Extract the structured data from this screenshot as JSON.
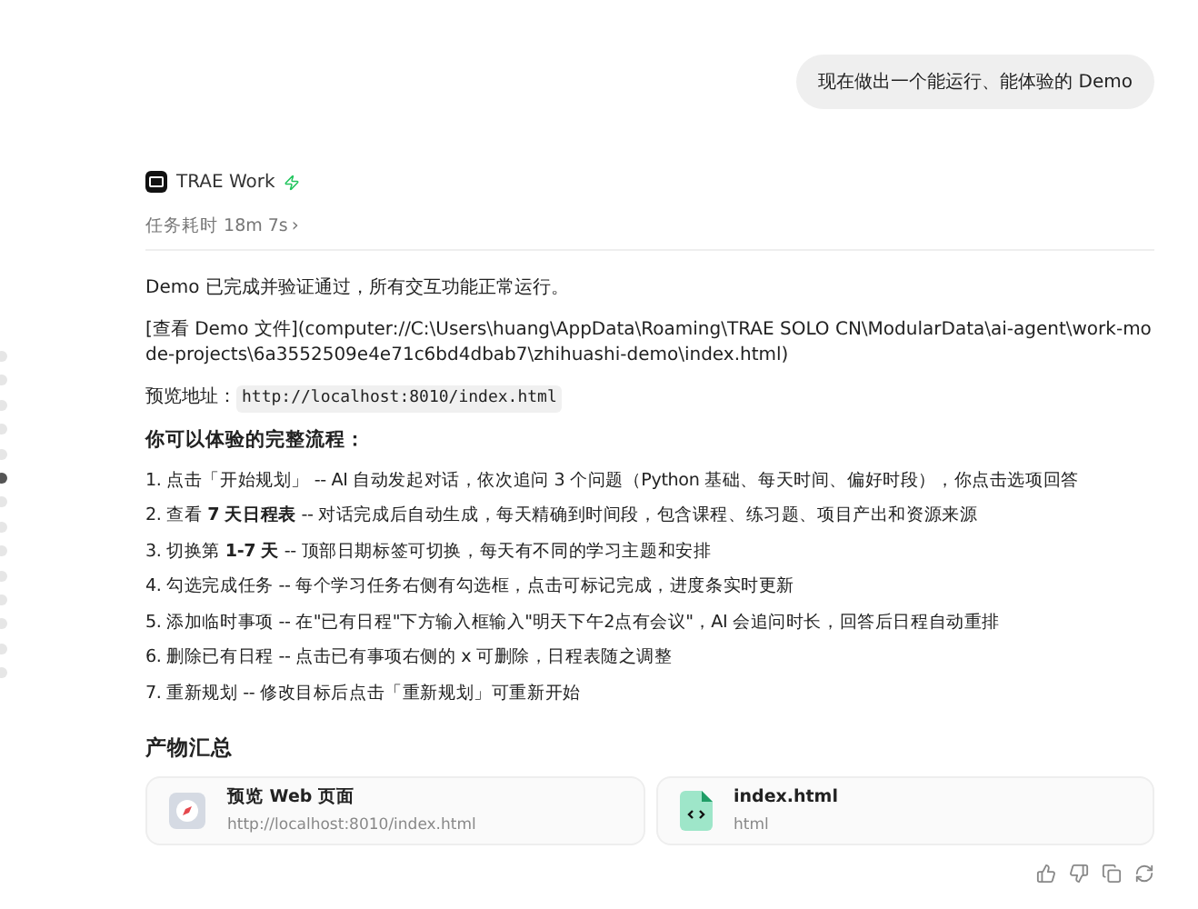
{
  "user_message": "现在做出一个能运行、能体验的 Demo",
  "agent": {
    "name": "TRAE Work",
    "duration": "任务耗时 18m 7s",
    "duration_chevron": "›"
  },
  "paragraphs": [
    "Demo 已完成并验证通过，所有交互功能正常运行。",
    "[查看 Demo 文件](computer://C:\\Users\\huang\\AppData\\Roaming\\TRAE SOLO CN\\ModularData\\ai-agent\\work-mode-projects\\6a3552509e4e71c6bd4dbab7\\zhihuashi-demo\\index.html)"
  ],
  "preview": {
    "label": "预览地址：",
    "url": "http://localhost:8010/index.html"
  },
  "flow_title": "你可以体验的完整流程：",
  "steps": [
    "1. 点击「开始规划」 -- AI 自动发起对话，依次追问 3 个问题（Python 基础、每天时间、偏好时段），你点击选项回答",
    "2. 查看 **7 天日程表** -- 对话完成后自动生成，每天精确到时间段，包含课程、练习题、项目产出和资源来源",
    "3. 切换第 **1-7 天** -- 顶部日期标签可切换，每天有不同的学习主题和安排",
    "4. 勾选完成任务 -- 每个学习任务右侧有勾选框，点击可标记完成，进度条实时更新",
    "5. 添加临时事项 -- 在\"已有日程\"下方输入框输入\"明天下午2点有会议\"，AI 会追问时长，回答后日程自动重排",
    "6. 删除已有日程 -- 点击已有事项右侧的 x 可删除，日程表随之调整",
    "7. 重新规划 -- 修改目标后点击「重新规划」可重新开始"
  ],
  "artifacts_title": "产物汇总",
  "artifacts": [
    {
      "kind": "web",
      "title": "预览 Web 页面",
      "subtitle": "http://localhost:8010/index.html"
    },
    {
      "kind": "file",
      "title": "index.html",
      "subtitle": "html"
    }
  ],
  "timeline_dots": [
    {
      "selected": false
    },
    {
      "selected": false
    },
    {
      "selected": false
    },
    {
      "selected": false
    },
    {
      "selected": false
    },
    {
      "selected": true
    },
    {
      "selected": false
    },
    {
      "selected": false
    },
    {
      "selected": false
    },
    {
      "selected": false
    },
    {
      "selected": false
    },
    {
      "selected": false
    },
    {
      "selected": false
    },
    {
      "selected": false
    }
  ],
  "actions": [
    {
      "kind": "like"
    },
    {
      "kind": "dislike"
    },
    {
      "kind": "copy"
    },
    {
      "kind": "retry"
    }
  ]
}
